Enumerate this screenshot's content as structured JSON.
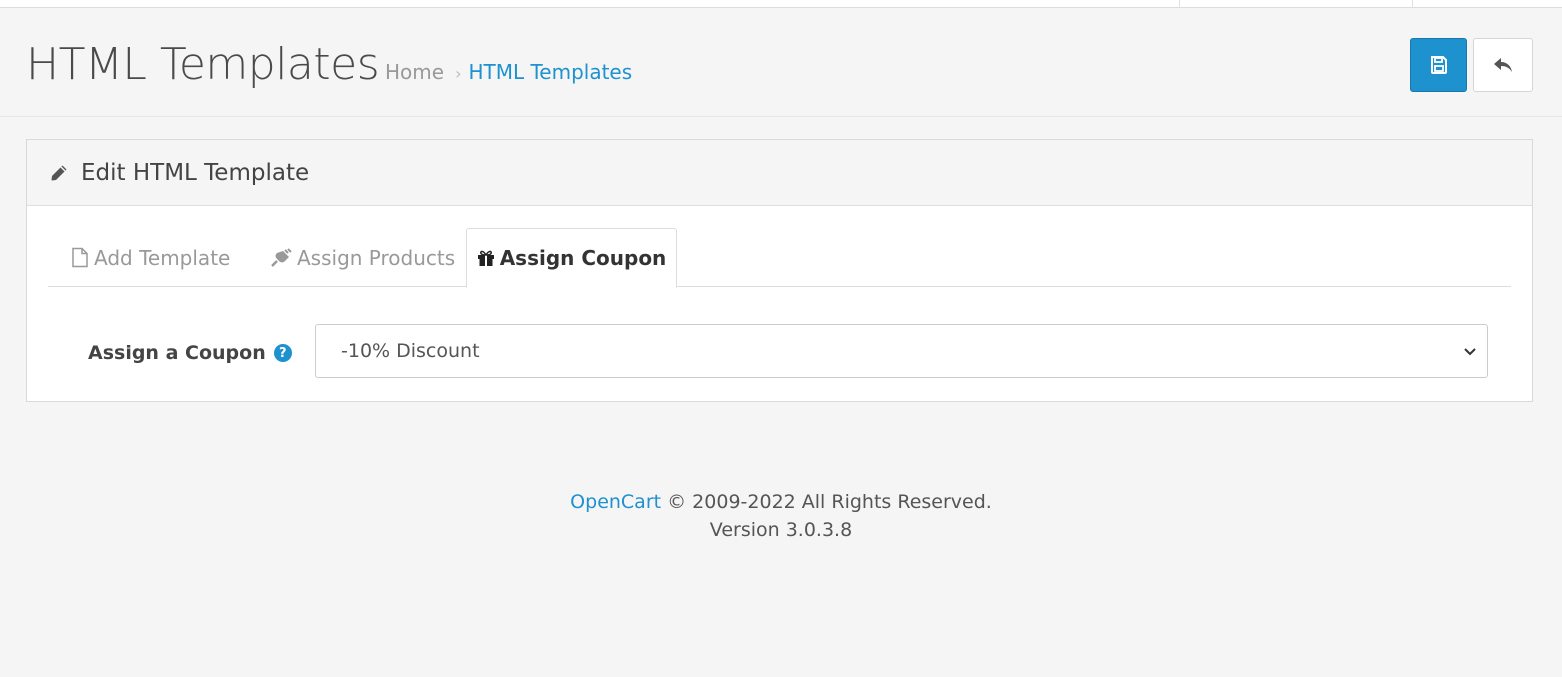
{
  "header": {
    "title": "HTML Templates",
    "breadcrumb": [
      {
        "label": "Home"
      },
      {
        "label": "HTML Templates"
      }
    ],
    "breadcrumb_separator": "›",
    "save_icon": "floppy-disk-icon",
    "back_icon": "reply-arrow-icon"
  },
  "panel": {
    "icon": "pencil-icon",
    "title": "Edit HTML Template"
  },
  "tabs": [
    {
      "label": "Add Template",
      "icon": "file-icon",
      "active": false
    },
    {
      "label": "Assign Products",
      "icon": "plug-icon",
      "active": false
    },
    {
      "label": "Assign Coupon",
      "icon": "gift-icon",
      "active": true
    }
  ],
  "form": {
    "coupon_label": "Assign a Coupon",
    "help_icon_text": "?",
    "coupon_selected": "-10% Discount"
  },
  "footer": {
    "brand": "OpenCart",
    "copyright": "© 2009-2022 All Rights Reserved.",
    "version": "Version 3.0.3.8"
  },
  "colors": {
    "accent": "#1e91cf",
    "background": "#f5f5f5",
    "text": "#333333"
  }
}
